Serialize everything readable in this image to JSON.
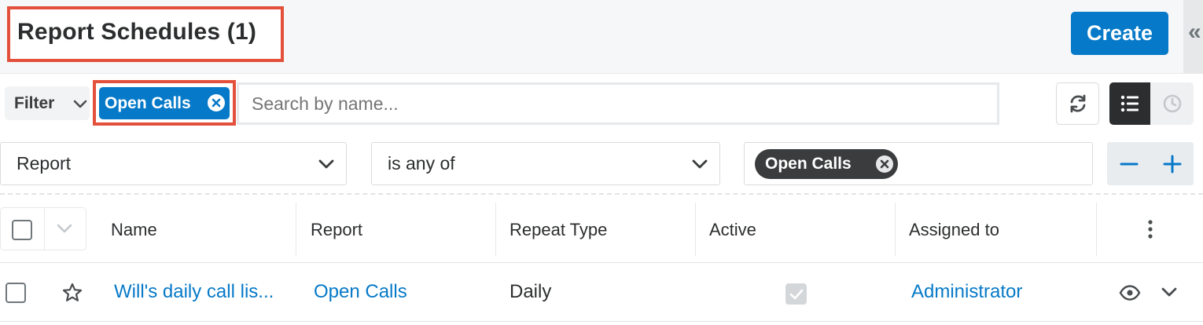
{
  "header": {
    "title": "Report Schedules (1)",
    "create_label": "Create",
    "collapse_glyph": "«"
  },
  "filter_bar": {
    "filter_label": "Filter",
    "active_filter_chip": "Open Calls",
    "search_placeholder": "Search by name..."
  },
  "filter_definition": {
    "field": "Report",
    "operator": "is any of",
    "values": [
      "Open Calls"
    ]
  },
  "table": {
    "columns": [
      "Name",
      "Report",
      "Repeat Type",
      "Active",
      "Assigned to"
    ],
    "rows": [
      {
        "name": "Will's daily call lis...",
        "report": "Open Calls",
        "repeat_type": "Daily",
        "active": true,
        "assigned_to": "Administrator"
      }
    ]
  },
  "colors": {
    "accent": "#0679c8",
    "highlight_outline": "#e3503b",
    "dark": "#2b2d2e"
  }
}
